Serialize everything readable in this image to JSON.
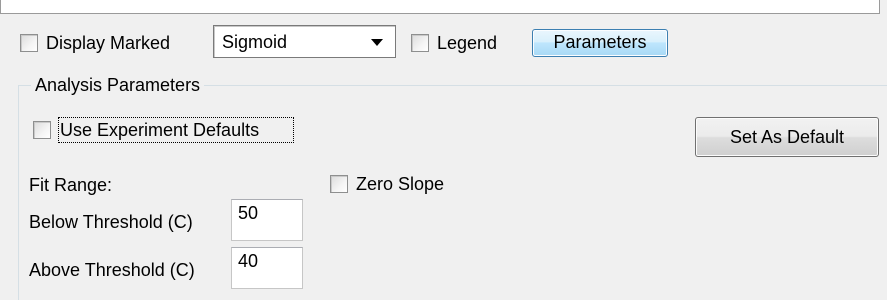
{
  "toolbar": {
    "display_marked_label": "Display Marked",
    "display_marked_checked": false,
    "fit_model_selected": "Sigmoid",
    "legend_label": "Legend",
    "legend_checked": false,
    "parameters_button_label": "Parameters"
  },
  "analysis_parameters": {
    "group_title": "Analysis Parameters",
    "use_experiment_defaults_label": "Use Experiment Defaults",
    "use_experiment_defaults_checked": false,
    "set_as_default_button_label": "Set As Default",
    "fit_range_label": "Fit Range:",
    "zero_slope_label": "Zero Slope",
    "zero_slope_checked": false,
    "below_threshold_label": "Below Threshold (C)",
    "below_threshold_value": "50",
    "above_threshold_label": "Above Threshold (C)",
    "above_threshold_value": "40"
  },
  "colors": {
    "window_background": "#f0f0f0",
    "active_button_border": "#3c7fb1",
    "active_button_fill": "#bee6fd",
    "groupbox_border": "#d5dfe5"
  },
  "icons": {
    "combo_arrow": "chevron-down-icon"
  }
}
